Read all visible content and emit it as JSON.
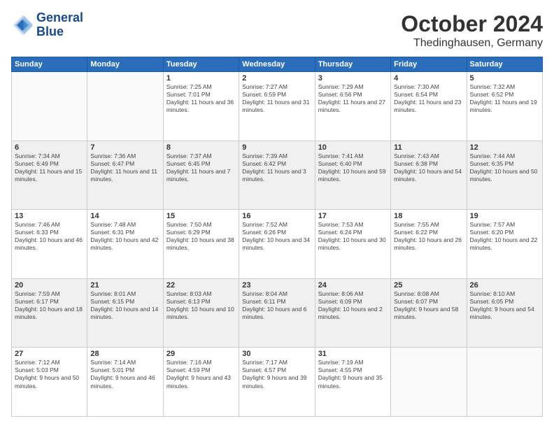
{
  "header": {
    "logo_line1": "General",
    "logo_line2": "Blue",
    "month": "October 2024",
    "location": "Thedinghausen, Germany"
  },
  "weekdays": [
    "Sunday",
    "Monday",
    "Tuesday",
    "Wednesday",
    "Thursday",
    "Friday",
    "Saturday"
  ],
  "weeks": [
    [
      {
        "day": "",
        "sunrise": "",
        "sunset": "",
        "daylight": ""
      },
      {
        "day": "",
        "sunrise": "",
        "sunset": "",
        "daylight": ""
      },
      {
        "day": "1",
        "sunrise": "Sunrise: 7:25 AM",
        "sunset": "Sunset: 7:01 PM",
        "daylight": "Daylight: 11 hours and 36 minutes."
      },
      {
        "day": "2",
        "sunrise": "Sunrise: 7:27 AM",
        "sunset": "Sunset: 6:59 PM",
        "daylight": "Daylight: 11 hours and 31 minutes."
      },
      {
        "day": "3",
        "sunrise": "Sunrise: 7:29 AM",
        "sunset": "Sunset: 6:56 PM",
        "daylight": "Daylight: 11 hours and 27 minutes."
      },
      {
        "day": "4",
        "sunrise": "Sunrise: 7:30 AM",
        "sunset": "Sunset: 6:54 PM",
        "daylight": "Daylight: 11 hours and 23 minutes."
      },
      {
        "day": "5",
        "sunrise": "Sunrise: 7:32 AM",
        "sunset": "Sunset: 6:52 PM",
        "daylight": "Daylight: 11 hours and 19 minutes."
      }
    ],
    [
      {
        "day": "6",
        "sunrise": "Sunrise: 7:34 AM",
        "sunset": "Sunset: 6:49 PM",
        "daylight": "Daylight: 11 hours and 15 minutes."
      },
      {
        "day": "7",
        "sunrise": "Sunrise: 7:36 AM",
        "sunset": "Sunset: 6:47 PM",
        "daylight": "Daylight: 11 hours and 11 minutes."
      },
      {
        "day": "8",
        "sunrise": "Sunrise: 7:37 AM",
        "sunset": "Sunset: 6:45 PM",
        "daylight": "Daylight: 11 hours and 7 minutes."
      },
      {
        "day": "9",
        "sunrise": "Sunrise: 7:39 AM",
        "sunset": "Sunset: 6:42 PM",
        "daylight": "Daylight: 11 hours and 3 minutes."
      },
      {
        "day": "10",
        "sunrise": "Sunrise: 7:41 AM",
        "sunset": "Sunset: 6:40 PM",
        "daylight": "Daylight: 10 hours and 59 minutes."
      },
      {
        "day": "11",
        "sunrise": "Sunrise: 7:43 AM",
        "sunset": "Sunset: 6:38 PM",
        "daylight": "Daylight: 10 hours and 54 minutes."
      },
      {
        "day": "12",
        "sunrise": "Sunrise: 7:44 AM",
        "sunset": "Sunset: 6:35 PM",
        "daylight": "Daylight: 10 hours and 50 minutes."
      }
    ],
    [
      {
        "day": "13",
        "sunrise": "Sunrise: 7:46 AM",
        "sunset": "Sunset: 6:33 PM",
        "daylight": "Daylight: 10 hours and 46 minutes."
      },
      {
        "day": "14",
        "sunrise": "Sunrise: 7:48 AM",
        "sunset": "Sunset: 6:31 PM",
        "daylight": "Daylight: 10 hours and 42 minutes."
      },
      {
        "day": "15",
        "sunrise": "Sunrise: 7:50 AM",
        "sunset": "Sunset: 6:29 PM",
        "daylight": "Daylight: 10 hours and 38 minutes."
      },
      {
        "day": "16",
        "sunrise": "Sunrise: 7:52 AM",
        "sunset": "Sunset: 6:26 PM",
        "daylight": "Daylight: 10 hours and 34 minutes."
      },
      {
        "day": "17",
        "sunrise": "Sunrise: 7:53 AM",
        "sunset": "Sunset: 6:24 PM",
        "daylight": "Daylight: 10 hours and 30 minutes."
      },
      {
        "day": "18",
        "sunrise": "Sunrise: 7:55 AM",
        "sunset": "Sunset: 6:22 PM",
        "daylight": "Daylight: 10 hours and 26 minutes."
      },
      {
        "day": "19",
        "sunrise": "Sunrise: 7:57 AM",
        "sunset": "Sunset: 6:20 PM",
        "daylight": "Daylight: 10 hours and 22 minutes."
      }
    ],
    [
      {
        "day": "20",
        "sunrise": "Sunrise: 7:59 AM",
        "sunset": "Sunset: 6:17 PM",
        "daylight": "Daylight: 10 hours and 18 minutes."
      },
      {
        "day": "21",
        "sunrise": "Sunrise: 8:01 AM",
        "sunset": "Sunset: 6:15 PM",
        "daylight": "Daylight: 10 hours and 14 minutes."
      },
      {
        "day": "22",
        "sunrise": "Sunrise: 8:03 AM",
        "sunset": "Sunset: 6:13 PM",
        "daylight": "Daylight: 10 hours and 10 minutes."
      },
      {
        "day": "23",
        "sunrise": "Sunrise: 8:04 AM",
        "sunset": "Sunset: 6:11 PM",
        "daylight": "Daylight: 10 hours and 6 minutes."
      },
      {
        "day": "24",
        "sunrise": "Sunrise: 8:06 AM",
        "sunset": "Sunset: 6:09 PM",
        "daylight": "Daylight: 10 hours and 2 minutes."
      },
      {
        "day": "25",
        "sunrise": "Sunrise: 8:08 AM",
        "sunset": "Sunset: 6:07 PM",
        "daylight": "Daylight: 9 hours and 58 minutes."
      },
      {
        "day": "26",
        "sunrise": "Sunrise: 8:10 AM",
        "sunset": "Sunset: 6:05 PM",
        "daylight": "Daylight: 9 hours and 54 minutes."
      }
    ],
    [
      {
        "day": "27",
        "sunrise": "Sunrise: 7:12 AM",
        "sunset": "Sunset: 5:03 PM",
        "daylight": "Daylight: 9 hours and 50 minutes."
      },
      {
        "day": "28",
        "sunrise": "Sunrise: 7:14 AM",
        "sunset": "Sunset: 5:01 PM",
        "daylight": "Daylight: 9 hours and 46 minutes."
      },
      {
        "day": "29",
        "sunrise": "Sunrise: 7:16 AM",
        "sunset": "Sunset: 4:59 PM",
        "daylight": "Daylight: 9 hours and 43 minutes."
      },
      {
        "day": "30",
        "sunrise": "Sunrise: 7:17 AM",
        "sunset": "Sunset: 4:57 PM",
        "daylight": "Daylight: 9 hours and 39 minutes."
      },
      {
        "day": "31",
        "sunrise": "Sunrise: 7:19 AM",
        "sunset": "Sunset: 4:55 PM",
        "daylight": "Daylight: 9 hours and 35 minutes."
      },
      {
        "day": "",
        "sunrise": "",
        "sunset": "",
        "daylight": ""
      },
      {
        "day": "",
        "sunrise": "",
        "sunset": "",
        "daylight": ""
      }
    ]
  ]
}
